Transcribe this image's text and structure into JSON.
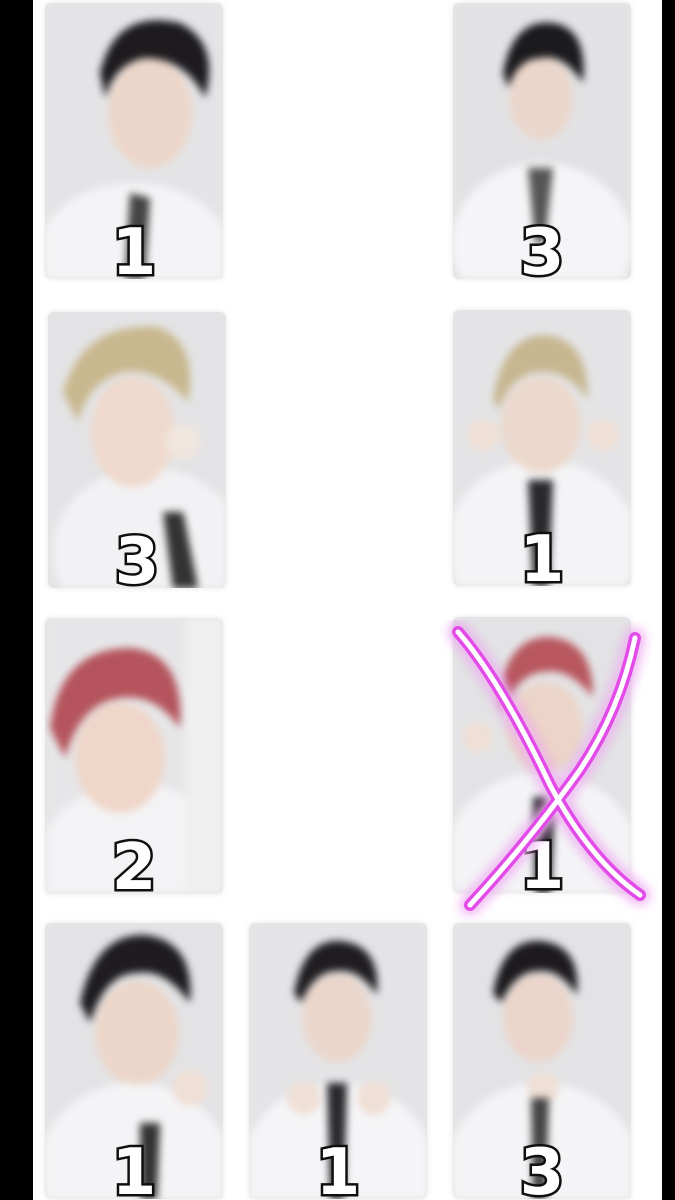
{
  "cards": [
    {
      "id": "r1-left",
      "count": "1",
      "hair": "#1d1b1e"
    },
    {
      "id": "r1-right",
      "count": "3",
      "hair": "#1b1a1d"
    },
    {
      "id": "r2-left",
      "count": "3",
      "hair": "#c9b88e"
    },
    {
      "id": "r2-right",
      "count": "1",
      "hair": "#c7b690"
    },
    {
      "id": "r3-left",
      "count": "2",
      "hair": "#b5545c"
    },
    {
      "id": "r3-right",
      "count": "1",
      "hair": "#b8575e",
      "crossed_out": true
    },
    {
      "id": "r4-left",
      "count": "1",
      "hair": "#1e1c1f"
    },
    {
      "id": "r4-mid",
      "count": "1",
      "hair": "#1f1d20"
    },
    {
      "id": "r4-right",
      "count": "3",
      "hair": "#1c1a1d"
    }
  ],
  "cross_mark_color": "#e24be8"
}
